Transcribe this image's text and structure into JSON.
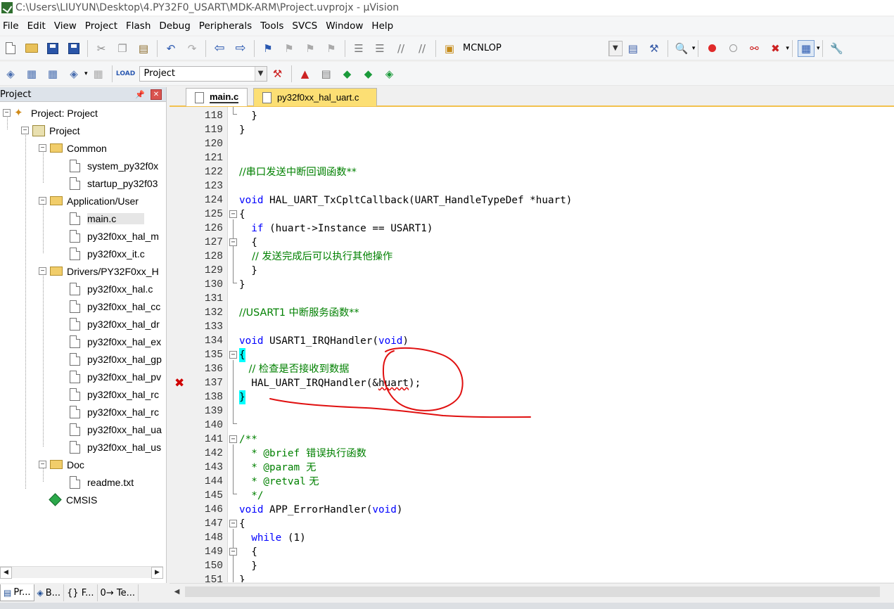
{
  "window": {
    "title": "C:\\Users\\LIUYUN\\Desktop\\4.PY32F0_USART\\MDK-ARM\\Project.uvprojx - µVision"
  },
  "menu": [
    "File",
    "Edit",
    "View",
    "Project",
    "Flash",
    "Debug",
    "Peripherals",
    "Tools",
    "SVCS",
    "Window",
    "Help"
  ],
  "toolbar1": {
    "target_label": "MCNLOP"
  },
  "toolbar2": {
    "target_select": "Project"
  },
  "project_panel": {
    "title": "Project",
    "pin_icon": "pin-icon",
    "close_icon": "close-icon",
    "tree": {
      "root": "Project: Project",
      "target": "Project",
      "groups": [
        {
          "name": "Common",
          "files": [
            "system_py32f0x",
            "startup_py32f03"
          ]
        },
        {
          "name": "Application/User",
          "files": [
            "main.c",
            "py32f0xx_hal_m",
            "py32f0xx_it.c"
          ]
        },
        {
          "name": "Drivers/PY32F0xx_H",
          "files": [
            "py32f0xx_hal.c",
            "py32f0xx_hal_cc",
            "py32f0xx_hal_dr",
            "py32f0xx_hal_ex",
            "py32f0xx_hal_gp",
            "py32f0xx_hal_pv",
            "py32f0xx_hal_rc",
            "py32f0xx_hal_rc",
            "py32f0xx_hal_ua",
            "py32f0xx_hal_us"
          ]
        },
        {
          "name": "Doc",
          "files": [
            "readme.txt"
          ]
        }
      ],
      "cmsis": "CMSIS"
    },
    "bottom_tabs": [
      "Pr...",
      "B...",
      "{} F...",
      "0→ Te..."
    ]
  },
  "editor": {
    "tabs": [
      "main.c",
      "py32f0xx_hal_uart.c"
    ],
    "active_tab": "main.c",
    "lines": {
      "l118": {
        "no": "118",
        "text": "  }"
      },
      "l119": {
        "no": "119",
        "text": "}"
      },
      "l120": {
        "no": "120",
        "text": ""
      },
      "l121": {
        "no": "121",
        "text": ""
      },
      "l122": {
        "no": "122",
        "text": "//串口发送中断回调函数**"
      },
      "l123": {
        "no": "123",
        "text": ""
      },
      "l124": {
        "no": "124",
        "kw": "void",
        "text": " HAL_UART_TxCpltCallback(UART_HandleTypeDef *huart)"
      },
      "l125": {
        "no": "125",
        "text": "{"
      },
      "l126": {
        "no": "126",
        "kw": "if",
        "text": " (huart->Instance == USART1)"
      },
      "l127": {
        "no": "127",
        "text": "  {"
      },
      "l128": {
        "no": "128",
        "text": "    // 发送完成后可以执行其他操作"
      },
      "l129": {
        "no": "129",
        "text": "  }"
      },
      "l130": {
        "no": "130",
        "text": "}"
      },
      "l131": {
        "no": "131",
        "text": ""
      },
      "l132": {
        "no": "132",
        "text": "//USART1 中断服务函数**"
      },
      "l133": {
        "no": "133",
        "text": ""
      },
      "l134": {
        "no": "134",
        "kw": "void",
        "text_a": " USART1_IRQHandler(",
        "kw2": "void",
        "text_b": ")"
      },
      "l135": {
        "no": "135",
        "text": "{"
      },
      "l136": {
        "no": "136",
        "text": "   // 检查是否接收到数据"
      },
      "l137": {
        "no": "137",
        "text_a": "  HAL_UART_IRQHandler(&",
        "err": "huart",
        "text_b": ");"
      },
      "l138": {
        "no": "138",
        "text": "}"
      },
      "l139": {
        "no": "139",
        "text": ""
      },
      "l140": {
        "no": "140",
        "text": ""
      },
      "l141": {
        "no": "141",
        "text": "/**"
      },
      "l142": {
        "no": "142",
        "tag": "  * @brief",
        "text": "  错误执行函数"
      },
      "l143": {
        "no": "143",
        "tag": "  * @param",
        "text": "  无"
      },
      "l144": {
        "no": "144",
        "tag": "  * @retval",
        "text": " 无"
      },
      "l145": {
        "no": "145",
        "text": "  */"
      },
      "l146": {
        "no": "146",
        "kw": "void",
        "text_a": " APP_ErrorHandler(",
        "kw2": "void",
        "text_b": ")"
      },
      "l147": {
        "no": "147",
        "text": "{"
      },
      "l148": {
        "no": "148",
        "kw": "while",
        "text": " (1)"
      },
      "l149": {
        "no": "149",
        "text": "  {"
      },
      "l150": {
        "no": "150",
        "text": "  }"
      },
      "l151": {
        "no": "151",
        "text": "}"
      }
    },
    "error_marker_icon": "error-x-icon"
  },
  "colors": {
    "keyword": "#0000ff",
    "comment": "#008000",
    "error_marker": "#d00000",
    "active_tab_accent": "#f2c14e",
    "annotation_ink": "#e01010"
  }
}
